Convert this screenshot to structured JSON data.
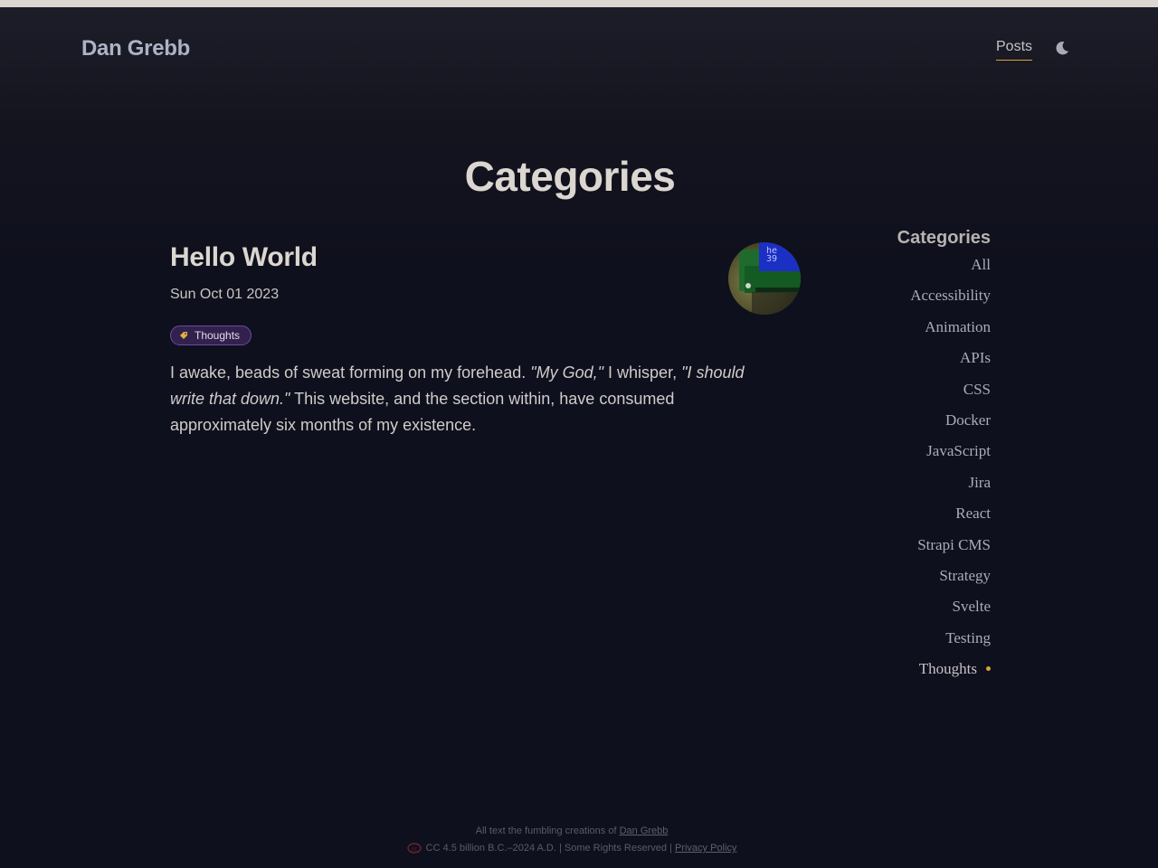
{
  "header": {
    "site_name": "Dan Grebb",
    "nav_posts": "Posts",
    "theme_toggle_icon": "moon-icon",
    "accent_color": "#d9a23a"
  },
  "main": {
    "title": "Categories"
  },
  "posts": [
    {
      "title": "Hello World",
      "date": "Sun Oct 01 2023",
      "tag": "Thoughts",
      "tag_icon": "tag-icon",
      "thumbnail_icon": "lcd-display-photo",
      "excerpt": {
        "part1": "I awake, beads of sweat forming on my forehead. ",
        "quote1": "\"My God,\"",
        "part2": " I whisper, ",
        "quote2": "\"I should write that down.\"",
        "part3": " This website, and the section within, have consumed approximately six months of my existence."
      }
    }
  ],
  "sidebar": {
    "title": "Categories",
    "items": [
      {
        "label": "All"
      },
      {
        "label": "Accessibility"
      },
      {
        "label": "Animation"
      },
      {
        "label": "APIs"
      },
      {
        "label": "CSS"
      },
      {
        "label": "Docker"
      },
      {
        "label": "JavaScript"
      },
      {
        "label": "Jira"
      },
      {
        "label": "React"
      },
      {
        "label": "Strapi CMS"
      },
      {
        "label": "Strategy"
      },
      {
        "label": "Svelte"
      },
      {
        "label": "Testing"
      },
      {
        "label": "Thoughts",
        "active": true
      }
    ]
  },
  "footer": {
    "line1_prefix": "All text the fumbling creations of ",
    "line1_link": "Dan Grebb",
    "license_icon": "cc-icon",
    "line2_text": "CC 4.5 billion B.C.–2024 A.D. | Some Rights Reserved | ",
    "line2_link": "Privacy Policy"
  }
}
